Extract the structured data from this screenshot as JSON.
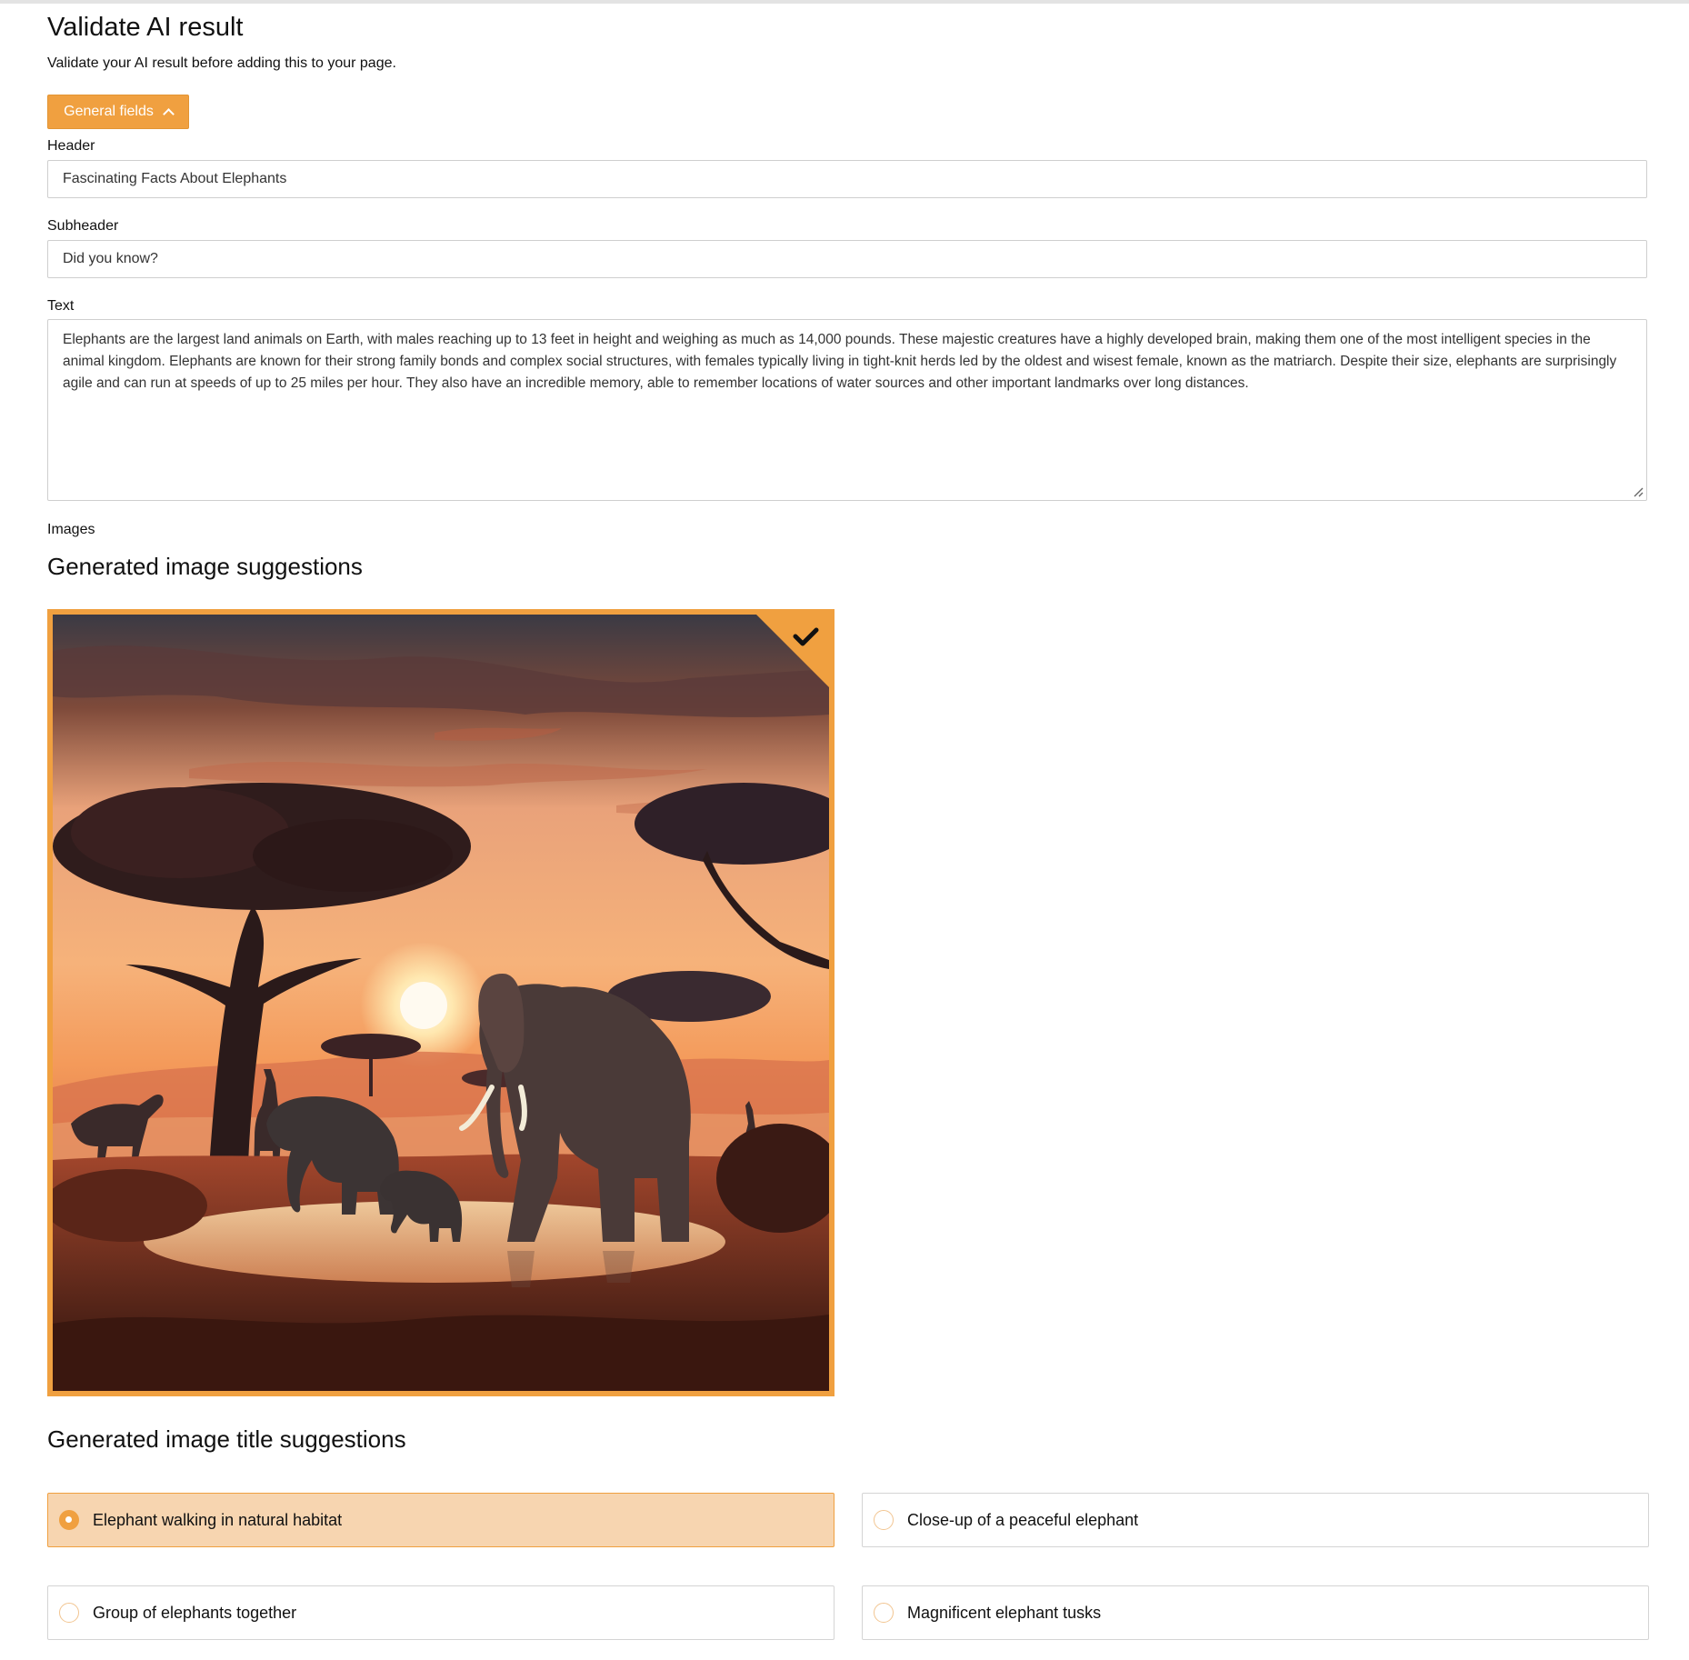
{
  "page": {
    "title": "Validate AI result",
    "description": "Validate your AI result before adding this to your page."
  },
  "general_fields_button": {
    "label": "General fields",
    "expanded": true
  },
  "fields": {
    "header": {
      "label": "Header",
      "value": "Fascinating Facts About Elephants"
    },
    "subheader": {
      "label": "Subheader",
      "value": "Did you know?"
    },
    "text": {
      "label": "Text",
      "value": "Elephants are the largest land animals on Earth, with males reaching up to 13 feet in height and weighing as much as 14,000 pounds. These majestic creatures have a highly developed brain, making them one of the most intelligent species in the animal kingdom. Elephants are known for their strong family bonds and complex social structures, with females typically living in tight-knit herds led by the oldest and wisest female, known as the matriarch. Despite their size, elephants are surprisingly agile and can run at speeds of up to 25 miles per hour. They also have an incredible memory, able to remember locations of water sources and other important landmarks over long distances."
    },
    "images": {
      "label": "Images"
    }
  },
  "image_suggestions": {
    "title": "Generated image suggestions",
    "items": [
      {
        "selected": true
      }
    ]
  },
  "title_suggestions": {
    "title": "Generated image title suggestions",
    "options": [
      {
        "label": "Elephant walking in natural habitat",
        "selected": true
      },
      {
        "label": "Close-up of a peaceful elephant",
        "selected": false
      },
      {
        "label": "Group of elephants together",
        "selected": false
      },
      {
        "label": "Magnificent elephant tusks",
        "selected": false
      }
    ]
  },
  "colors": {
    "accent": "#f0a040",
    "selected_option_bg": "#f7d5b0",
    "border": "#cfcfcf"
  },
  "icons": [
    "chevron-up-icon",
    "checkmark-icon",
    "resize-grip-icon",
    "radio-icon"
  ]
}
